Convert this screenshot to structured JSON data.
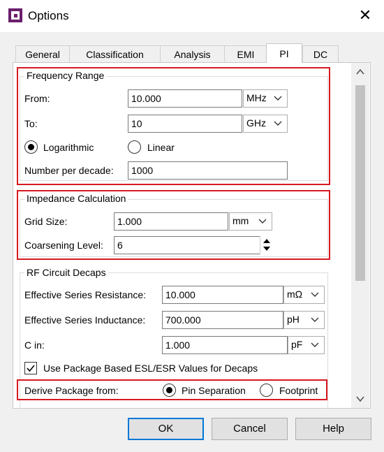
{
  "window": {
    "title": "Options",
    "close_glyph": "✕"
  },
  "tabs": [
    {
      "label": "General"
    },
    {
      "label": "Classification"
    },
    {
      "label": "Analysis"
    },
    {
      "label": "EMI"
    },
    {
      "label": "PI",
      "active": true
    },
    {
      "label": "DC"
    }
  ],
  "frequency_range": {
    "title": "Frequency Range",
    "from_label": "From:",
    "from_value": "10.000",
    "from_unit": "MHz",
    "to_label": "To:",
    "to_value": "10",
    "to_unit": "GHz",
    "log_label": "Logarithmic",
    "linear_label": "Linear",
    "selected_scale": "Logarithmic",
    "per_decade_label": "Number per decade:",
    "per_decade_value": "1000"
  },
  "impedance": {
    "title": "Impedance Calculation",
    "grid_label": "Grid Size:",
    "grid_value": "1.000",
    "grid_unit": "mm",
    "coarsening_label": "Coarsening Level:",
    "coarsening_value": "6"
  },
  "rf_decaps": {
    "title": "RF Circuit Decaps",
    "esr_label": "Effective Series Resistance:",
    "esr_value": "10.000",
    "esr_unit": "mΩ",
    "esl_label": "Effective Series Inductance:",
    "esl_value": "700.000",
    "esl_unit": "pH",
    "cin_label": "C in:",
    "cin_value": "1.000",
    "cin_unit": "pF",
    "use_pkg_label": "Use Package Based ESL/ESR Values for Decaps",
    "use_pkg_checked": true,
    "derive_label": "Derive Package from:",
    "pin_sep_label": "Pin Separation",
    "footprint_label": "Footprint",
    "derive_selected": "Pin Separation"
  },
  "buttons": {
    "ok": "OK",
    "cancel": "Cancel",
    "help": "Help"
  },
  "colors": {
    "highlight": "#d71920",
    "default_button_border": "#0078d7"
  }
}
